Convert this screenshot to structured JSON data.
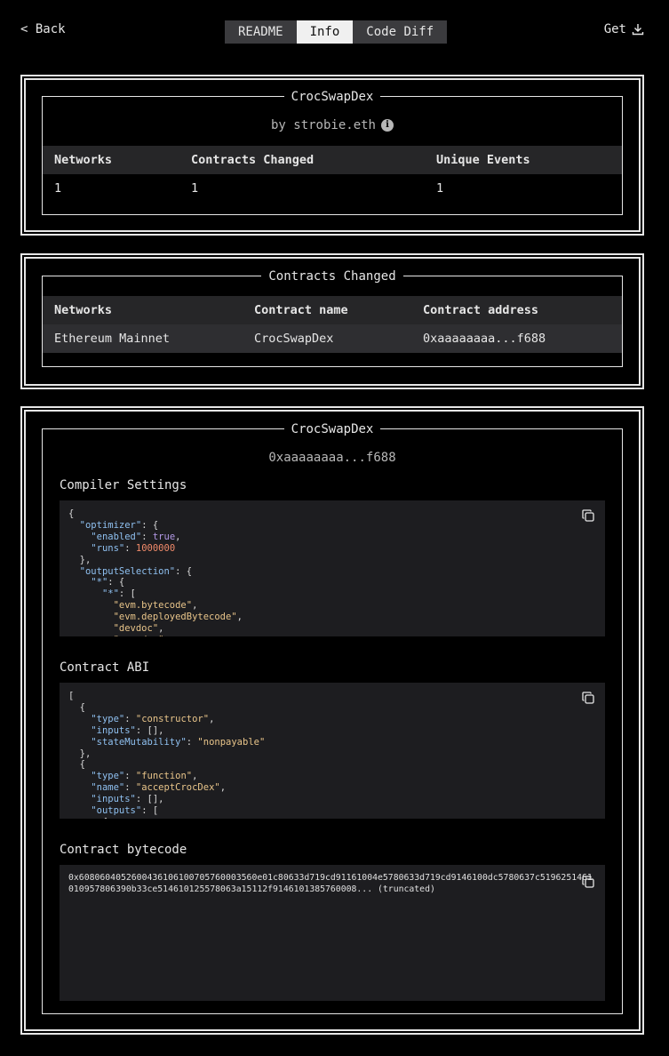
{
  "topbar": {
    "back_label": "< Back",
    "tabs": [
      "README",
      "Info",
      "Code Diff"
    ],
    "active_tab": "Info",
    "get_label": "Get"
  },
  "summary": {
    "title": "CrocSwapDex",
    "author": "by strobie.eth",
    "headers": [
      "Networks",
      "Contracts Changed",
      "Unique Events"
    ],
    "values": [
      "1",
      "1",
      "1"
    ]
  },
  "contracts_changed": {
    "title": "Contracts Changed",
    "headers": [
      "Networks",
      "Contract name",
      "Contract address"
    ],
    "rows": [
      [
        "Ethereum Mainnet",
        "CrocSwapDex",
        "0xaaaaaaaa...f688"
      ]
    ]
  },
  "contract": {
    "title": "CrocSwapDex",
    "address": "0xaaaaaaaa...f688",
    "compiler_title": "Compiler Settings",
    "abi_title": "Contract ABI",
    "bytecode_title": "Contract bytecode",
    "bytecode": "0x6080604052600436106100705760003560e01c80633d719cd91161004e5780633d719cd9146100dc5780637c5196251461010957806390b33ce514610125578063a15112f9146101385760008... (truncated)"
  }
}
